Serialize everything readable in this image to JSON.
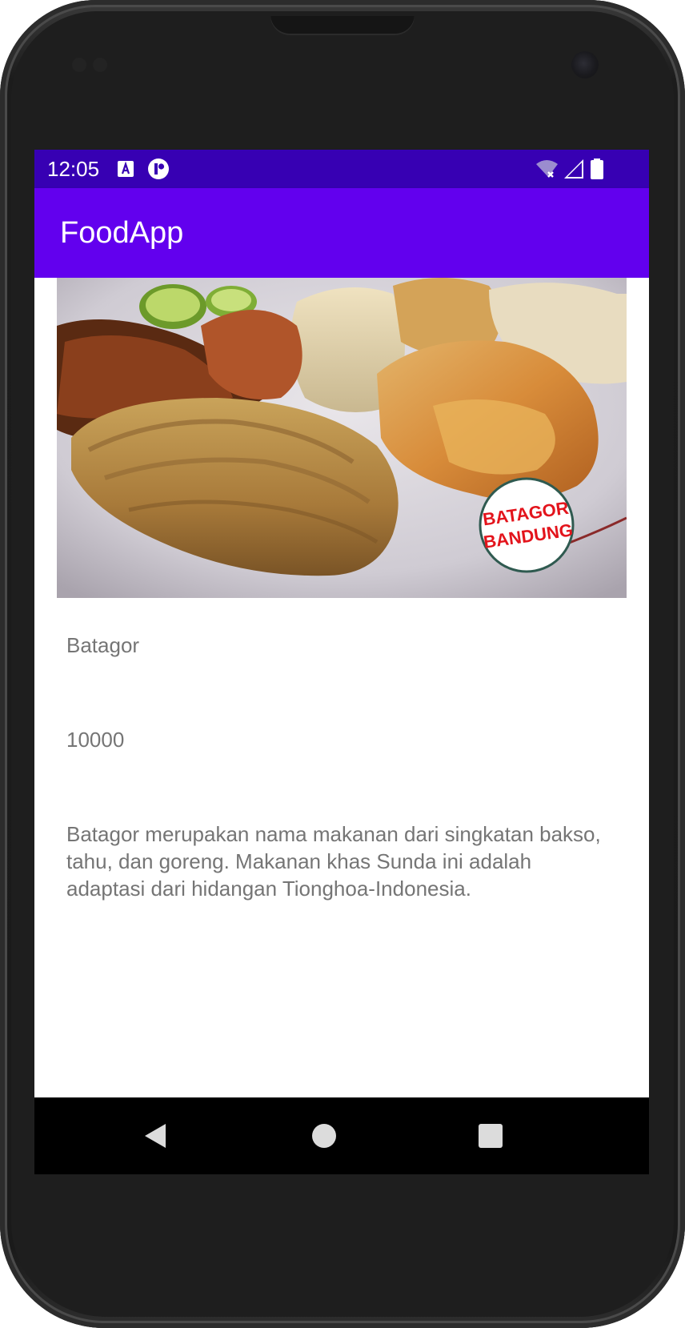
{
  "app": {
    "title": "FoodApp"
  },
  "status_bar": {
    "time": "12:05",
    "icons": [
      "notification-a-icon",
      "notification-circle-icon",
      "wifi-off-icon",
      "cell-signal-icon",
      "battery-icon"
    ]
  },
  "food": {
    "image_badge_line1": "BATAGOR",
    "image_badge_line2": "BANDUNG",
    "name": "Batagor",
    "price": "10000",
    "description": "Batagor merupakan nama makanan dari singkatan bakso, tahu, dan goreng. Makanan khas Sunda ini adalah adaptasi dari hidangan Tionghoa-Indonesia."
  },
  "nav_bar": {
    "buttons": [
      "back-icon",
      "home-icon",
      "recents-icon"
    ]
  },
  "colors": {
    "status_bar": "#3700b3",
    "app_bar": "#6200ee",
    "text_secondary": "#757575",
    "badge_text": "#e3141c"
  }
}
